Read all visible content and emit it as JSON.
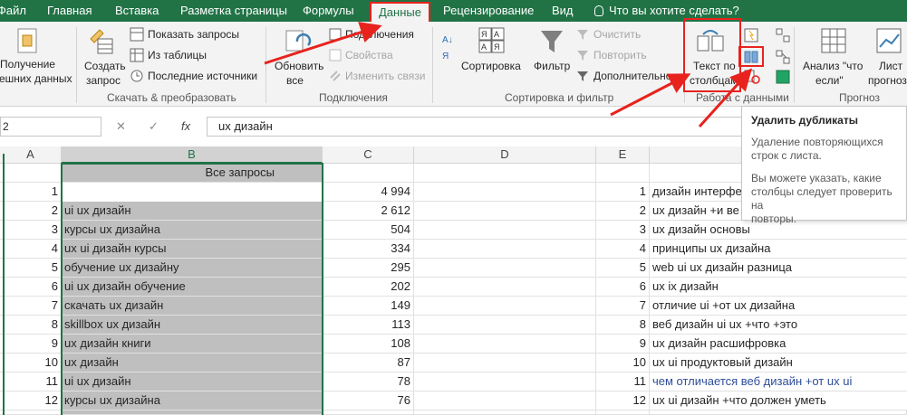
{
  "tabs": [
    "Файл",
    "Главная",
    "Вставка",
    "Разметка страницы",
    "Формулы",
    "Данные",
    "Рецензирование",
    "Вид"
  ],
  "active_tab": "Данные",
  "tell_me": "Что вы хотите сделать?",
  "ribbon": {
    "get_data": [
      "Получение",
      "внешних данных"
    ],
    "create_query": [
      "Создать",
      "запрос"
    ],
    "show_queries": "Показать запросы",
    "from_table": "Из таблицы",
    "recent_sources": "Последние источники",
    "group_transform": "Скачать & преобразовать",
    "refresh_all": [
      "Обновить",
      "все"
    ],
    "connections": "Подключения",
    "properties": "Свойства",
    "edit_links": "Изменить связи",
    "group_connections": "Подключения",
    "sort": "Сортировка",
    "filter": "Фильтр",
    "clear": "Очистить",
    "reapply": "Повторить",
    "advanced": "Дополнительно",
    "group_sort": "Сортировка и фильтр",
    "text_to_columns": [
      "Текст по",
      "столбцам"
    ],
    "group_data_tools": "Работа с данными",
    "what_if": [
      "Анализ \"что",
      "если\""
    ],
    "forecast_sheet": [
      "Лист",
      "прогноз"
    ],
    "group_forecast": "Прогноз"
  },
  "formula_bar": {
    "name_box": "2",
    "cancel": "✕",
    "enter": "✓",
    "fx": "fx",
    "formula": "ux дизайн"
  },
  "columns": [
    "A",
    "B",
    "C",
    "D",
    "E"
  ],
  "header_cell_b": "Все запросы",
  "rows_left": [
    {
      "n": "1",
      "q": "ux дизайн",
      "c": "4 994"
    },
    {
      "n": "2",
      "q": "ui ux дизайн",
      "c": "2 612"
    },
    {
      "n": "3",
      "q": "курсы ux дизайна",
      "c": "504"
    },
    {
      "n": "4",
      "q": "ux ui дизайн курсы",
      "c": "334"
    },
    {
      "n": "5",
      "q": "обучение ux дизайну",
      "c": "295"
    },
    {
      "n": "6",
      "q": "ui ux дизайн обучение",
      "c": "202"
    },
    {
      "n": "7",
      "q": "скачать ux дизайн",
      "c": "149"
    },
    {
      "n": "8",
      "q": "skillbox ux дизайн",
      "c": "113"
    },
    {
      "n": "9",
      "q": "ux дизайн книги",
      "c": "108"
    },
    {
      "n": "10",
      "q": "ux дизайн",
      "c": "87"
    },
    {
      "n": "11",
      "q": "ui ux дизайн",
      "c": "78"
    },
    {
      "n": "12",
      "q": "курсы ux дизайна",
      "c": "76"
    }
  ],
  "rows_right": [
    {
      "n": "1",
      "q": "дизайн интерфей"
    },
    {
      "n": "2",
      "q": "ux дизайн +и ве"
    },
    {
      "n": "3",
      "q": "ux дизайн основы"
    },
    {
      "n": "4",
      "q": "принципы ux дизайна"
    },
    {
      "n": "5",
      "q": "web ui ux дизайн разница"
    },
    {
      "n": "6",
      "q": "ux ix дизайн"
    },
    {
      "n": "7",
      "q": "отличие ui +от ux дизайна"
    },
    {
      "n": "8",
      "q": "веб дизайн ui ux +что +это"
    },
    {
      "n": "9",
      "q": "ux дизайн расшифровка"
    },
    {
      "n": "10",
      "q": "ux ui продуктовый дизайн"
    },
    {
      "n": "11",
      "q": "чем отличается веб дизайн +от ux ui"
    },
    {
      "n": "12",
      "q": "ux ui дизайн +что должен уметь"
    }
  ],
  "tooltip": {
    "title": "Удалить дубликаты",
    "body1": [
      "Удаление повторяющихся",
      "строк с листа."
    ],
    "body2": [
      "Вы можете указать, какие",
      "столбцы следует проверить на",
      "повторы."
    ]
  },
  "colors": {
    "excel_green": "#217346",
    "highlight_red": "#e8221d",
    "selection_gray": "#bfbfbf"
  }
}
